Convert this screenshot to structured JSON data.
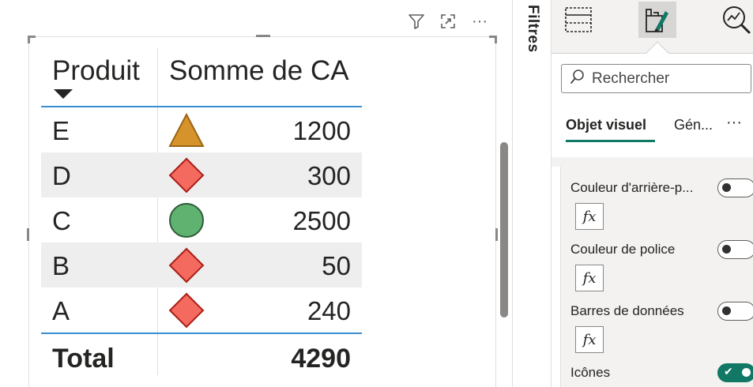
{
  "visual": {
    "header_icons": [
      "filter-icon",
      "focus-mode-icon",
      "more-options-icon"
    ],
    "more_glyph": "···"
  },
  "table": {
    "columns": [
      "Produit",
      "Somme de CA"
    ],
    "rows": [
      {
        "product": "E",
        "icon": "triangle",
        "value": "1200"
      },
      {
        "product": "D",
        "icon": "diamond",
        "value": "300"
      },
      {
        "product": "C",
        "icon": "circle",
        "value": "2500"
      },
      {
        "product": "B",
        "icon": "diamond",
        "value": "50"
      },
      {
        "product": "A",
        "icon": "diamond",
        "value": "240"
      }
    ],
    "total_label": "Total",
    "total_value": "4290",
    "colors": {
      "triangle": "#d6922b",
      "diamond": "#f46a5e",
      "circle": "#5fb270",
      "header_rule": "#3a8fd0"
    }
  },
  "filters": {
    "label": "Filtres"
  },
  "pane": {
    "search_placeholder": "Rechercher",
    "tabs": [
      {
        "label": "Objet visuel",
        "active": true
      },
      {
        "label": "Gén...",
        "active": false
      }
    ],
    "more": "···",
    "options": [
      {
        "name": "Couleur d'arrière-p...",
        "on": false,
        "fx": "fx"
      },
      {
        "name": "Couleur de police",
        "on": false,
        "fx": "fx"
      },
      {
        "name": "Barres de données",
        "on": false,
        "fx": "fx"
      },
      {
        "name": "Icônes",
        "on": true
      }
    ],
    "accent_color": "#117865"
  }
}
